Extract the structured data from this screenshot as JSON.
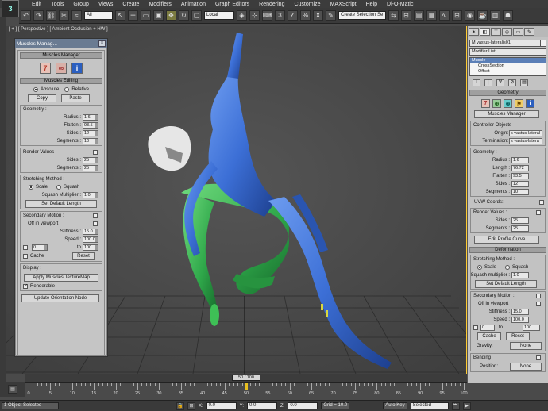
{
  "app": {
    "logo": "3",
    "menus": [
      "Edit",
      "Tools",
      "Group",
      "Views",
      "Create",
      "Modifiers",
      "Animation",
      "Graph Editors",
      "Rendering",
      "Customize",
      "MAXScript",
      "Help",
      "Di-O-Matic"
    ]
  },
  "toolbar": {
    "selection_filter": "All",
    "coord_system": "Local",
    "named_selection": "Create Selection Se"
  },
  "viewport": {
    "label": "[ + ] [ Perspective ] [ Ambient Occlusion + HW ]"
  },
  "muscles_window": {
    "title": "Muscles Manag...",
    "manager_head": "Muscles Manager",
    "editing_head": "Muscles Editing",
    "absolute": "Absolute",
    "relative": "Relative",
    "copy": "Copy",
    "paste": "Paste",
    "geometry": {
      "head": "Geometry :",
      "radius_label": "Radius :",
      "radius": "1.6",
      "flatten_label": "Flatten :",
      "flatten": "93.5",
      "sides_label": "Sides :",
      "sides": "12",
      "segments_label": "Segments :",
      "segments": "10"
    },
    "render": {
      "head": "Render Values :",
      "sides_label": "Sides :",
      "sides": "25",
      "segments_label": "Segments :",
      "segments": "25"
    },
    "stretch": {
      "head": "Stretching Method :",
      "scale": "Scale",
      "squash": "Squash",
      "multiplier_label": "Squash Multiplier :",
      "multiplier": "1.0",
      "set_default": "Set Default Length"
    },
    "secondary": {
      "head": "Secondary Motion :",
      "off_viewport": "Off in viewport :",
      "stiffness_label": "Stiffness :",
      "stiffness": "15.0",
      "speed_label": "Speed :",
      "speed": "100.0",
      "from": "0",
      "to_label": "to",
      "to": "100",
      "cache": "Cache",
      "reset": "Reset"
    },
    "display": {
      "head": "Display :",
      "apply_texture": "Apply Muscles TextureMap",
      "renderable": "Renderable"
    },
    "update": "Update Orientation Node"
  },
  "cmd_panel": {
    "object_name": "M vastus-lateralis01",
    "modifier_list": "Modifier List",
    "stack": [
      "Muscle",
      "CrossSection",
      "Offset"
    ],
    "geometry_head": "Geometry",
    "muscles_manager": "Muscles Manager",
    "controller_objects": "Controller Objects",
    "origin_label": "Origin:",
    "origin": "s vastus-lateral",
    "termination_label": "Termination:",
    "termination": "s vastus-latera",
    "geometry": {
      "head": "Geometry :",
      "radius_label": "Radius :",
      "radius": "1.6",
      "length_label": "Length :",
      "length": "76.72",
      "flatten_label": "Flatten :",
      "flatten": "93.5",
      "sides_label": "Sides :",
      "sides": "12",
      "segments_label": "Segments :",
      "segments": "10"
    },
    "uvw": "UVW Coords:",
    "render": {
      "head": "Render Values :",
      "sides_label": "Sides :",
      "sides": "25",
      "segments_label": "Segments :",
      "segments": "25"
    },
    "edit_profile": "Edit Profile Curve",
    "deformation_head": "Deformation",
    "stretch": {
      "head": "Stretching Method :",
      "scale": "Scale",
      "squash": "Squash",
      "multiplier_label": "Squash multiplier :",
      "multiplier": "1.0",
      "set_default": "Set Default Length"
    },
    "secondary": {
      "head": "Secondary Motion :",
      "off_viewport": "Off in viewport",
      "stiffness_label": "Stiffness :",
      "stiffness": "15.0",
      "speed_label": "Speed :",
      "speed": "100.0",
      "from": "0",
      "to_label": "to",
      "to": "100",
      "cache": "Cache",
      "reset": "Reset",
      "gravity_label": "Gravity:",
      "gravity": "None"
    },
    "bending": "Bending",
    "position_label": "Position:",
    "position": "None"
  },
  "timeline": {
    "frame_label": "50 / 100",
    "progress": 0.5,
    "ticks": [
      "0",
      "5",
      "10",
      "15",
      "20",
      "25",
      "30",
      "35",
      "40",
      "45",
      "50",
      "55",
      "60",
      "65",
      "70",
      "75",
      "80",
      "85",
      "90",
      "95",
      "100"
    ]
  },
  "status": {
    "selected": "1 Object Selected",
    "x_label": "X:",
    "x": "0.0",
    "y_label": "Y:",
    "y": "0.0",
    "z_label": "Z:",
    "z": "0.0",
    "grid": "Grid = 10.0",
    "autokey": "Auto Key",
    "selected_mode": "Selected"
  },
  "colors": {
    "muscle_blue": "#3c6fd6",
    "muscle_green": "#2fa84a",
    "viewport_border": "#ffcc33",
    "stack_selected": "#5b7fb7"
  }
}
